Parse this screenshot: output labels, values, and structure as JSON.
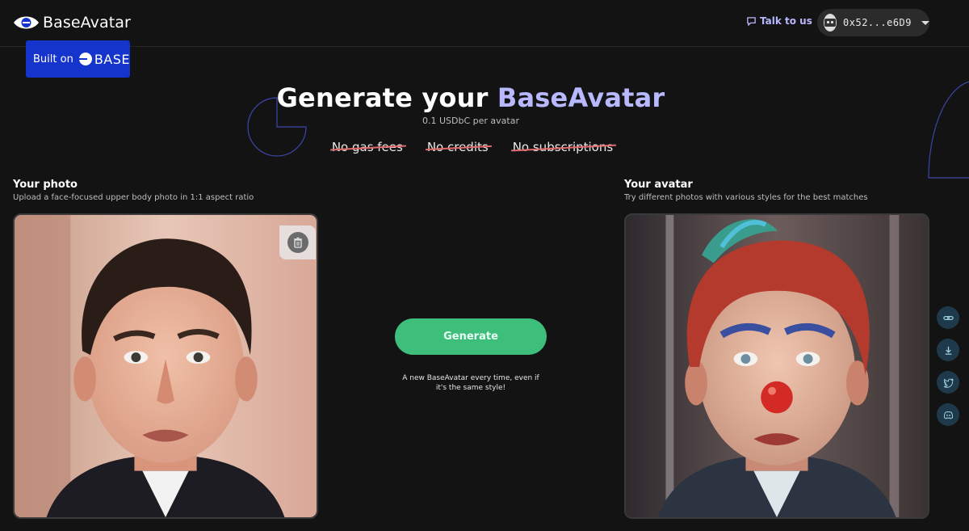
{
  "header": {
    "brand": "BaseAvatar",
    "talk_label": "Talk to us",
    "wallet_address": "0x52...e6D9"
  },
  "badge": {
    "built_on": "Built on",
    "base": "BASE"
  },
  "hero": {
    "title_prefix": "Generate your ",
    "title_accent": "BaseAvatar",
    "subtitle": "0.1 USDbC per avatar",
    "features": [
      "No gas fees",
      "No credits",
      "No subscriptions"
    ]
  },
  "left_panel": {
    "title": "Your photo",
    "description": "Upload a face-focused upper body photo in 1:1 aspect ratio"
  },
  "right_panel": {
    "title": "Your avatar",
    "description": "Try different photos with various styles for the best matches"
  },
  "generate": {
    "button_label": "Generate",
    "note": "A new BaseAvatar every time, even if it's the same style!"
  },
  "side_actions": [
    "link-icon",
    "download-icon",
    "twitter-icon",
    "discord-icon"
  ],
  "colors": {
    "background": "#131313",
    "accent": "#b8b8ff",
    "generate": "#3dbe7a",
    "base_blue": "#1434cb",
    "strike": "#e06a6a"
  }
}
